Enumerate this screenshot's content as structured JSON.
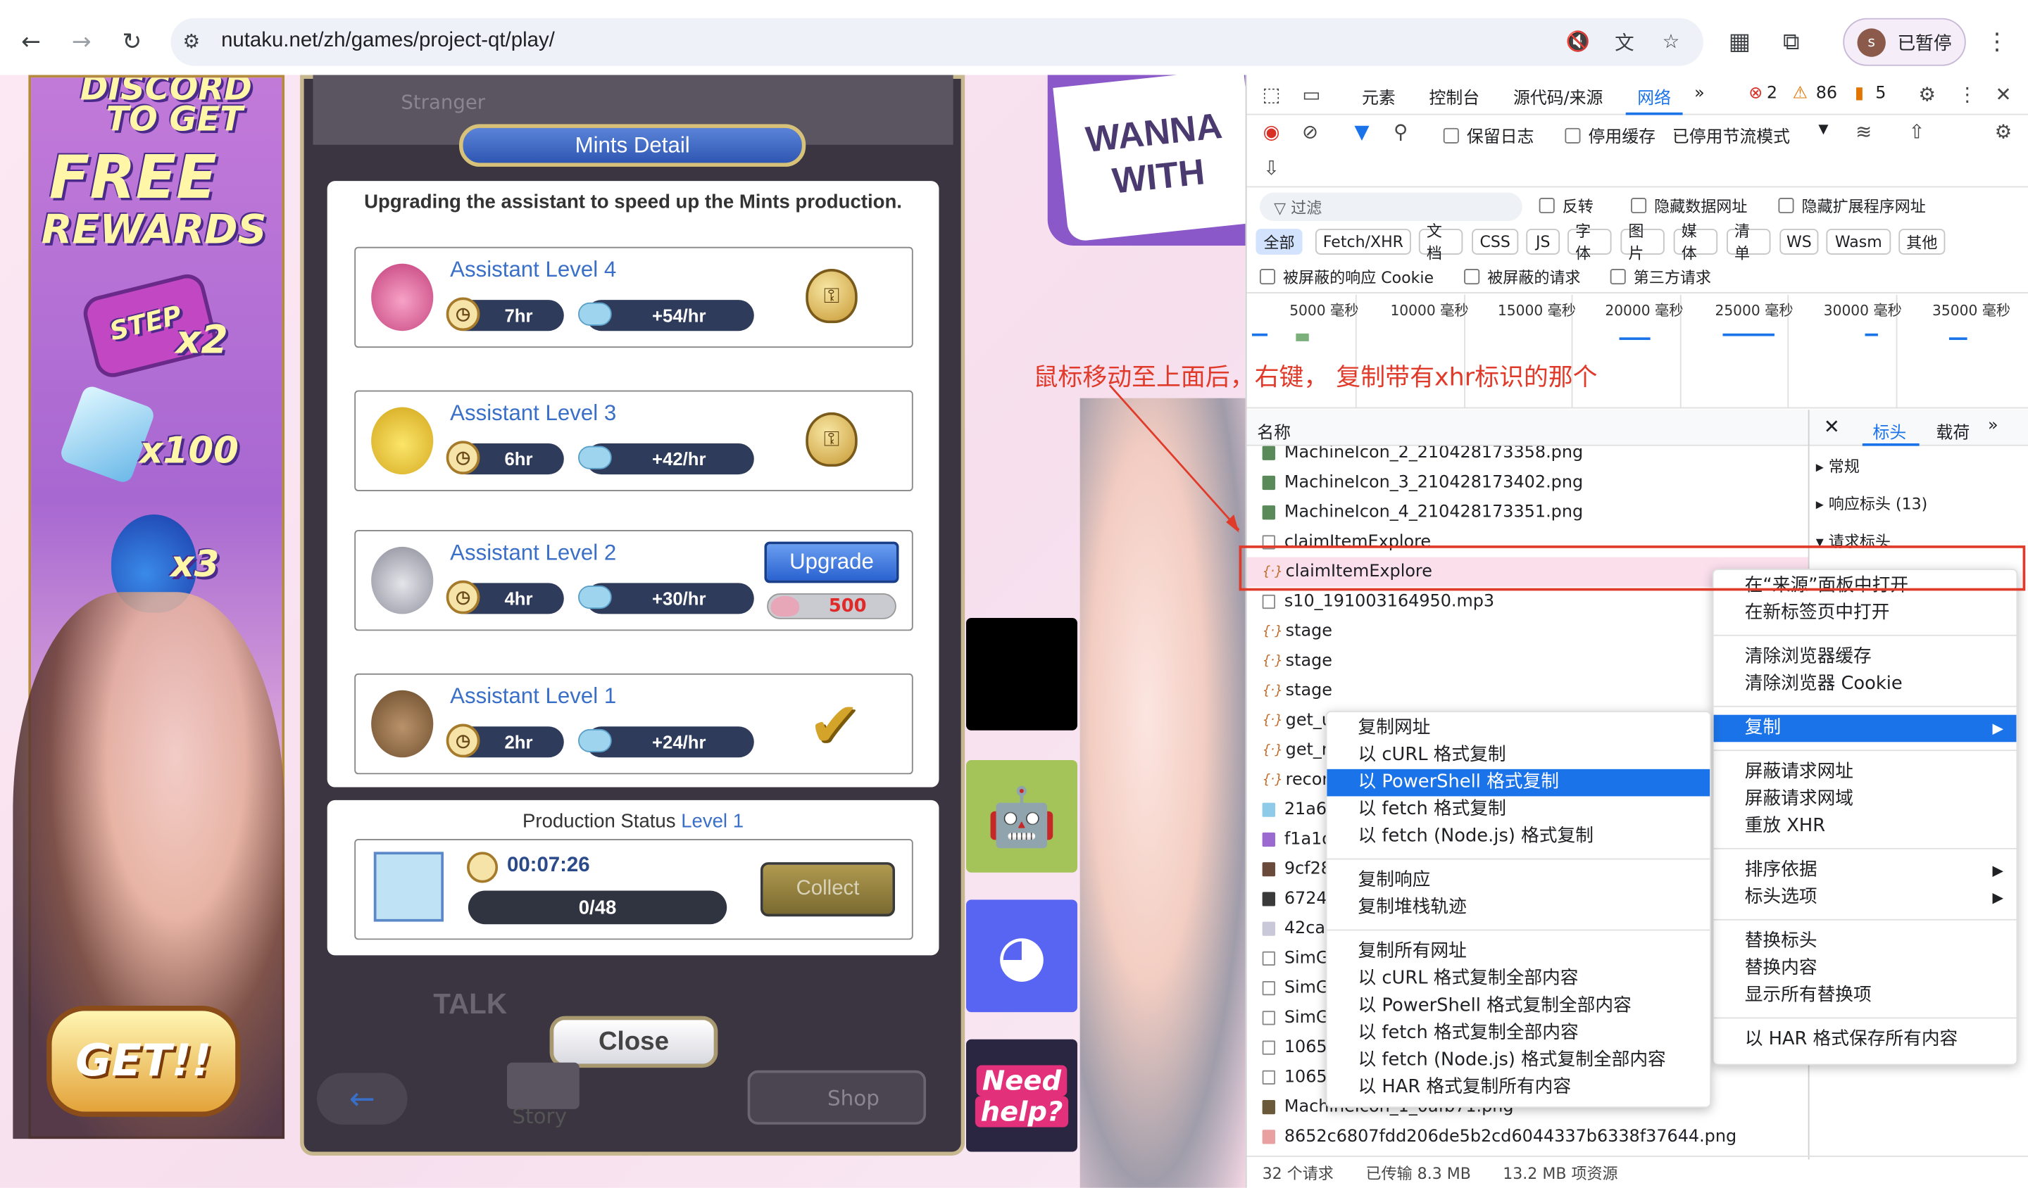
{
  "browser": {
    "url": "nutaku.net/zh/games/project-qt/play/",
    "profile_initial": "s",
    "profile_label": "已暂停"
  },
  "game": {
    "banner": {
      "line1": "DISCORD",
      "line2": "TO GET",
      "line3": "FREE",
      "line4": "REWARDS",
      "step": "STEP",
      "step_mult": "x2",
      "crystal_mult": "x100",
      "potion_mult": "x3",
      "get_button": "GET!!"
    },
    "panel_top_label": "Stranger",
    "mints_title": "Mints Detail",
    "description": "Upgrading the assistant to speed up the Mints production.",
    "levels": [
      {
        "name": "Assistant Level 4",
        "time": "7hr",
        "rate": "+54/hr",
        "state": "locked"
      },
      {
        "name": "Assistant Level 3",
        "time": "6hr",
        "rate": "+42/hr",
        "state": "locked"
      },
      {
        "name": "Assistant Level 2",
        "time": "4hr",
        "rate": "+30/hr",
        "state": "upgrade",
        "upgrade_label": "Upgrade",
        "cost": "500"
      },
      {
        "name": "Assistant Level 1",
        "time": "2hr",
        "rate": "+24/hr",
        "state": "done"
      }
    ],
    "status": {
      "title_prefix": "Production Status",
      "title_level": "Level 1",
      "timer": "00:07:26",
      "progress": "0/48",
      "collect_label": "Collect"
    },
    "talk_label": "TALK",
    "close_label": "Close",
    "story_label": "Story",
    "shop_label": "Shop",
    "need_help_line1": "Need",
    "need_help_line2": "help?",
    "wanna_line1": "WANNA",
    "wanna_line2": "WITH"
  },
  "annotation": "鼠标移动至上面后，右键， 复制带有xhr标识的那个",
  "devtools": {
    "tabs": [
      "元素",
      "控制台",
      "源代码/来源",
      "网络"
    ],
    "active_tab": "网络",
    "errors": "2",
    "warnings": "86",
    "issues": "5",
    "toolbar": {
      "preserve_log": "保留日志",
      "disable_cache": "停用缓存",
      "throttle": "已停用节流模式"
    },
    "filter": {
      "placeholder": "过滤",
      "invert": "反转",
      "hide_data_urls": "隐藏数据网址",
      "hide_ext_urls": "隐藏扩展程序网址"
    },
    "type_chips": [
      "全部",
      "Fetch/XHR",
      "文档",
      "CSS",
      "JS",
      "字体",
      "图片",
      "媒体",
      "清单",
      "WS",
      "Wasm",
      "其他"
    ],
    "options": {
      "blocked_cookies": "被屏蔽的响应 Cookie",
      "blocked_requests": "被屏蔽的请求",
      "third_party": "第三方请求"
    },
    "timeline_ticks": [
      "5000 毫秒",
      "10000 毫秒",
      "15000 毫秒",
      "20000 毫秒",
      "25000 毫秒",
      "30000 毫秒",
      "35000 毫秒"
    ],
    "name_header": "名称",
    "requests": [
      {
        "name": "MachineIcon_2_210428173358.png",
        "type": "img"
      },
      {
        "name": "MachineIcon_3_210428173402.png",
        "type": "img"
      },
      {
        "name": "MachineIcon_4_210428173351.png",
        "type": "img"
      },
      {
        "name": "claimItemExplore",
        "type": "doc"
      },
      {
        "name": "claimItemExplore",
        "type": "xhr"
      },
      {
        "name": "s10_191003164950.mp3",
        "type": "doc"
      },
      {
        "name": "stage",
        "type": "xhr"
      },
      {
        "name": "stage",
        "type": "xhr"
      },
      {
        "name": "stage",
        "type": "xhr"
      },
      {
        "name": "get_us",
        "type": "xhr"
      },
      {
        "name": "get_ne",
        "type": "xhr"
      },
      {
        "name": "record",
        "type": "xhr"
      },
      {
        "name": "21a6a",
        "type": "img"
      },
      {
        "name": "f1a1d1",
        "type": "img"
      },
      {
        "name": "9cf28",
        "type": "img"
      },
      {
        "name": "6724b",
        "type": "img"
      },
      {
        "name": "42ca5",
        "type": "img"
      },
      {
        "name": "SimGi",
        "type": "doc"
      },
      {
        "name": "SimGi",
        "type": "doc"
      },
      {
        "name": "SimGi",
        "type": "doc"
      },
      {
        "name": "1065_",
        "type": "doc"
      },
      {
        "name": "1065_",
        "type": "doc"
      },
      {
        "name": "MachineIcon_1_0afb71.png",
        "type": "img"
      },
      {
        "name": "8652c6807fdd206de5b2cd6044337b6338f37644.png",
        "type": "img"
      }
    ],
    "side_tabs": [
      "标头",
      "载荷"
    ],
    "side_sections": [
      "常规",
      "响应标头 (13)",
      "请求标头"
    ],
    "status_bar": {
      "requests": "32 个请求",
      "transferred": "已传输 8.3 MB",
      "resources": "13.2 MB 项资源"
    }
  },
  "context_menu": {
    "groups": [
      [
        "在“来源”面板中打开",
        "在新标签页中打开"
      ],
      [
        "清除浏览器缓存",
        "清除浏览器 Cookie"
      ],
      [
        "复制"
      ],
      [
        "屏蔽请求网址",
        "屏蔽请求网域",
        "重放 XHR"
      ],
      [
        "排序依据",
        "标头选项"
      ],
      [
        "替换标头",
        "替换内容",
        "显示所有替换项"
      ],
      [
        "以 HAR 格式保存所有内容"
      ]
    ]
  },
  "copy_submenu": {
    "groups": [
      [
        "复制网址",
        "以 cURL 格式复制",
        "以 PowerShell 格式复制",
        "以 fetch 格式复制",
        "以 fetch (Node.js) 格式复制"
      ],
      [
        "复制响应",
        "复制堆栈轨迹"
      ],
      [
        "复制所有网址",
        "以 cURL 格式复制全部内容",
        "以 PowerShell 格式复制全部内容",
        "以 fetch 格式复制全部内容",
        "以 fetch (Node.js) 格式复制全部内容",
        "以 HAR 格式复制所有内容"
      ]
    ],
    "selected": "以 PowerShell 格式复制"
  }
}
